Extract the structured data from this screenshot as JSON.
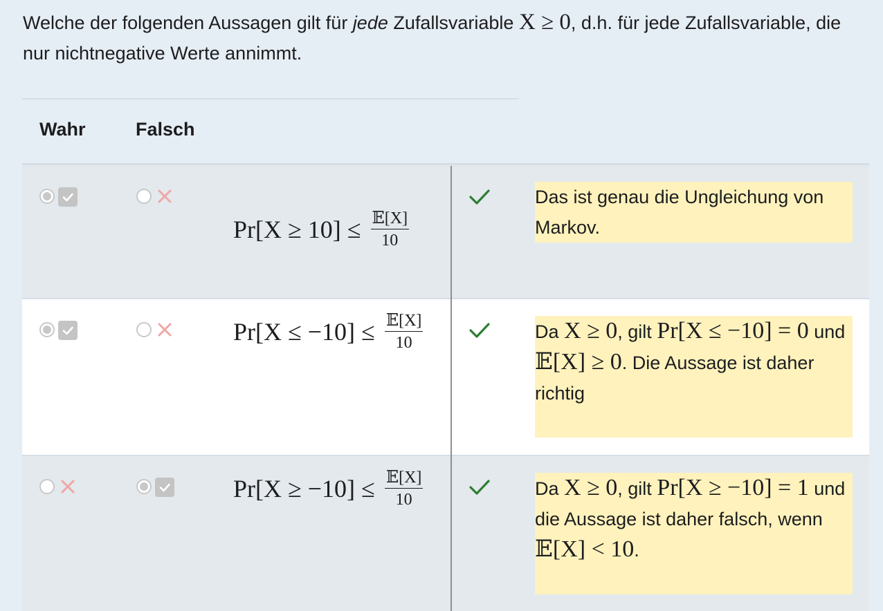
{
  "question": {
    "part1": "Welche der folgenden Aussagen gilt für ",
    "emph": "jede",
    "part2": " Zufallsvariable ",
    "math": "X ≥ 0",
    "part3": ", d.h. für jede Zufallsvariable, die nur nichtnegative Werte annimmt."
  },
  "columns": {
    "true_label": "Wahr",
    "false_label": "Falsch"
  },
  "rows": [
    {
      "selected": "Wahr",
      "formula_lhs": "Pr[X ≥ 10] ≤",
      "frac_num": "𝔼[X]",
      "frac_den": "10",
      "correct": true,
      "feedback": {
        "text": "Das ist genau die Ungleichung von Markov."
      }
    },
    {
      "selected": "Wahr",
      "formula_lhs": "Pr[X ≤ −10] ≤",
      "frac_num": "𝔼[X]",
      "frac_den": "10",
      "correct": true,
      "feedback": {
        "t1": "Da ",
        "m1": "X ≥ 0",
        "t2": ", gilt ",
        "m2": "Pr[X ≤ −10] = 0",
        "t3": " und ",
        "m3": "𝔼[X] ≥ 0",
        "t4": ". Die Aussage ist daher richtig"
      }
    },
    {
      "selected": "Falsch",
      "formula_lhs": "Pr[X ≥ −10] ≤",
      "frac_num": "𝔼[X]",
      "frac_den": "10",
      "correct": true,
      "feedback": {
        "t1": "Da ",
        "m1": "X ≥ 0",
        "t2": ", gilt ",
        "m2": "Pr[X ≥ −10] = 1",
        "t3": " und die Aussage ist daher falsch, wenn ",
        "m3": "𝔼[X] < 10",
        "t4": "."
      }
    }
  ],
  "colors": {
    "correct_green": "#2e7d32",
    "wrong_red": "#f0a6a6",
    "feedback_bg": "#fff2bd"
  }
}
